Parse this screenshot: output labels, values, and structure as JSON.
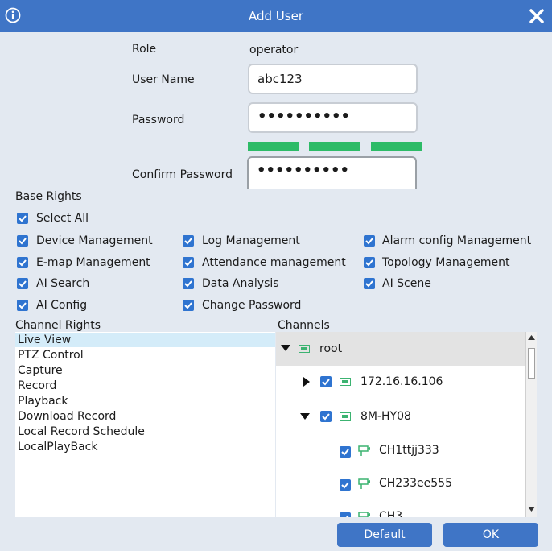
{
  "window": {
    "title": "Add User"
  },
  "form": {
    "role_label": "Role",
    "role_value": "operator",
    "username_label": "User Name",
    "username_value": "abc123",
    "password_label": "Password",
    "password_value": "••••••••••",
    "confirm_label": "Confirm Password",
    "confirm_value": "••••••••••"
  },
  "base_rights": {
    "heading": "Base Rights",
    "select_all": "Select All",
    "items": [
      "Device Management",
      "Log Management",
      "Alarm config Management",
      "E-map Management",
      "Attendance management",
      "Topology Management",
      "AI Search",
      "Data Analysis",
      "AI Scene",
      "AI Config",
      "Change Password"
    ]
  },
  "channel_rights": {
    "heading": "Channel Rights",
    "items": [
      "Live View",
      "PTZ Control",
      "Capture",
      "Record",
      "Playback",
      "Download Record",
      "Local Record Schedule",
      "LocalPlayBack"
    ],
    "selected": "Live View"
  },
  "channels": {
    "heading": "Channels",
    "nodes": [
      "root",
      "172.16.16.106",
      "8M-HY08",
      "CH1ttjj333",
      "CH233ee555",
      "CH3"
    ]
  },
  "buttons": {
    "default": "Default",
    "ok": "OK"
  },
  "colors": {
    "accent": "#3f75c6",
    "checkbox": "#2f74d0",
    "strength": "#2dbb67",
    "selection": "#d4ecf9"
  }
}
